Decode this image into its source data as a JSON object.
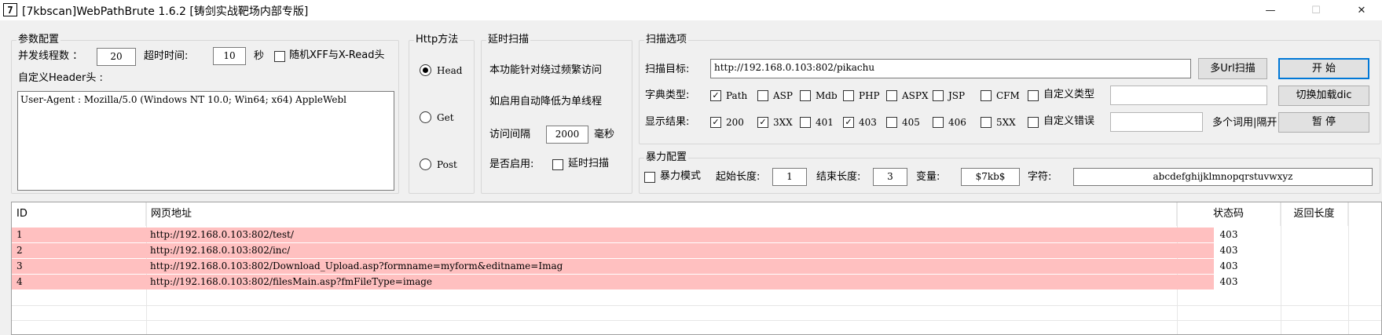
{
  "window": {
    "icon_label": "7",
    "title": "[7kbscan]WebPathBrute 1.6.2 [铸剑实战靶场内部专版]",
    "controls": {
      "minimize": "—",
      "maximize": "☐",
      "close": "✕"
    }
  },
  "params": {
    "title": "参数配置",
    "threads_label": "并发线程数 ：",
    "threads_value": "20",
    "timeout_label": "超时时间:",
    "timeout_value": "10",
    "timeout_unit": "秒",
    "random_xff_label": "随机XFF与X-Read头",
    "random_xff_checked": false,
    "header_label": "自定义Header头 :",
    "header_value": "User-Agent : Mozilla/5.0 (Windows NT 10.0; Win64; x64) AppleWebl"
  },
  "http": {
    "title": "Http方法",
    "methods": [
      {
        "label": "Head",
        "checked": true
      },
      {
        "label": "Get",
        "checked": false
      },
      {
        "label": "Post",
        "checked": false
      }
    ]
  },
  "delay": {
    "title": "延时扫描",
    "line1": "本功能针对绕过频繁访问",
    "line2": "如启用自动降低为单线程",
    "interval_label": "访问间隔",
    "interval_value": "2000",
    "interval_unit": "毫秒",
    "enable_label": "是否启用:",
    "enable_checkbox_label": "延时扫描",
    "enable_checked": false
  },
  "scan": {
    "title": "扫描选项",
    "target_label": "扫描目标:",
    "target_value": "http://192.168.0.103:802/pikachu",
    "multi_url_button": "多Url扫描",
    "start_button": "开 始",
    "dict_label": "字典类型:",
    "dict_types": [
      {
        "label": "Path",
        "checked": true
      },
      {
        "label": "ASP",
        "checked": false
      },
      {
        "label": "Mdb",
        "checked": false
      },
      {
        "label": "PHP",
        "checked": false
      },
      {
        "label": "ASPX",
        "checked": false
      },
      {
        "label": "JSP",
        "checked": false
      },
      {
        "label": "CFM",
        "checked": false
      },
      {
        "label": "自定义类型",
        "checked": false
      }
    ],
    "custom_type_value": "",
    "load_dict_button": "切换加载dic",
    "result_label": "显示结果:",
    "result_codes": [
      {
        "label": "200",
        "checked": true
      },
      {
        "label": "3XX",
        "checked": true
      },
      {
        "label": "401",
        "checked": false
      },
      {
        "label": "403",
        "checked": true
      },
      {
        "label": "405",
        "checked": false
      },
      {
        "label": "406",
        "checked": false
      },
      {
        "label": "5XX",
        "checked": false
      },
      {
        "label": "自定义错误",
        "checked": false
      }
    ],
    "custom_error_value": "",
    "separator_hint": "多个词用|隔开",
    "pause_button": "暂 停"
  },
  "brute": {
    "title": "暴力配置",
    "mode_label": "暴力模式",
    "mode_checked": false,
    "start_len_label": "起始长度:",
    "start_len_value": "1",
    "end_len_label": "结束长度:",
    "end_len_value": "3",
    "var_label": "变量:",
    "var_value": "$7kb$",
    "charset_label": "字符:",
    "charset_value": "abcdefghijklmnopqrstuvwxyz"
  },
  "results": {
    "columns": [
      "ID",
      "网页地址",
      "状态码",
      "返回长度"
    ],
    "rows": [
      {
        "id": "1",
        "url": "http://192.168.0.103:802/test/",
        "status": "403",
        "length": ""
      },
      {
        "id": "2",
        "url": "http://192.168.0.103:802/inc/",
        "status": "403",
        "length": ""
      },
      {
        "id": "3",
        "url": "http://192.168.0.103:802/Download_Upload.asp?formname=myform&editname=Imag",
        "status": "403",
        "length": ""
      },
      {
        "id": "4",
        "url": "http://192.168.0.103:802/filesMain.asp?fmFileType=image",
        "status": "403",
        "length": ""
      }
    ],
    "row_highlight_color": "#ffc0c0"
  },
  "colors": {
    "accent": "#0078d7",
    "window_bg": "#f0f0f0"
  }
}
